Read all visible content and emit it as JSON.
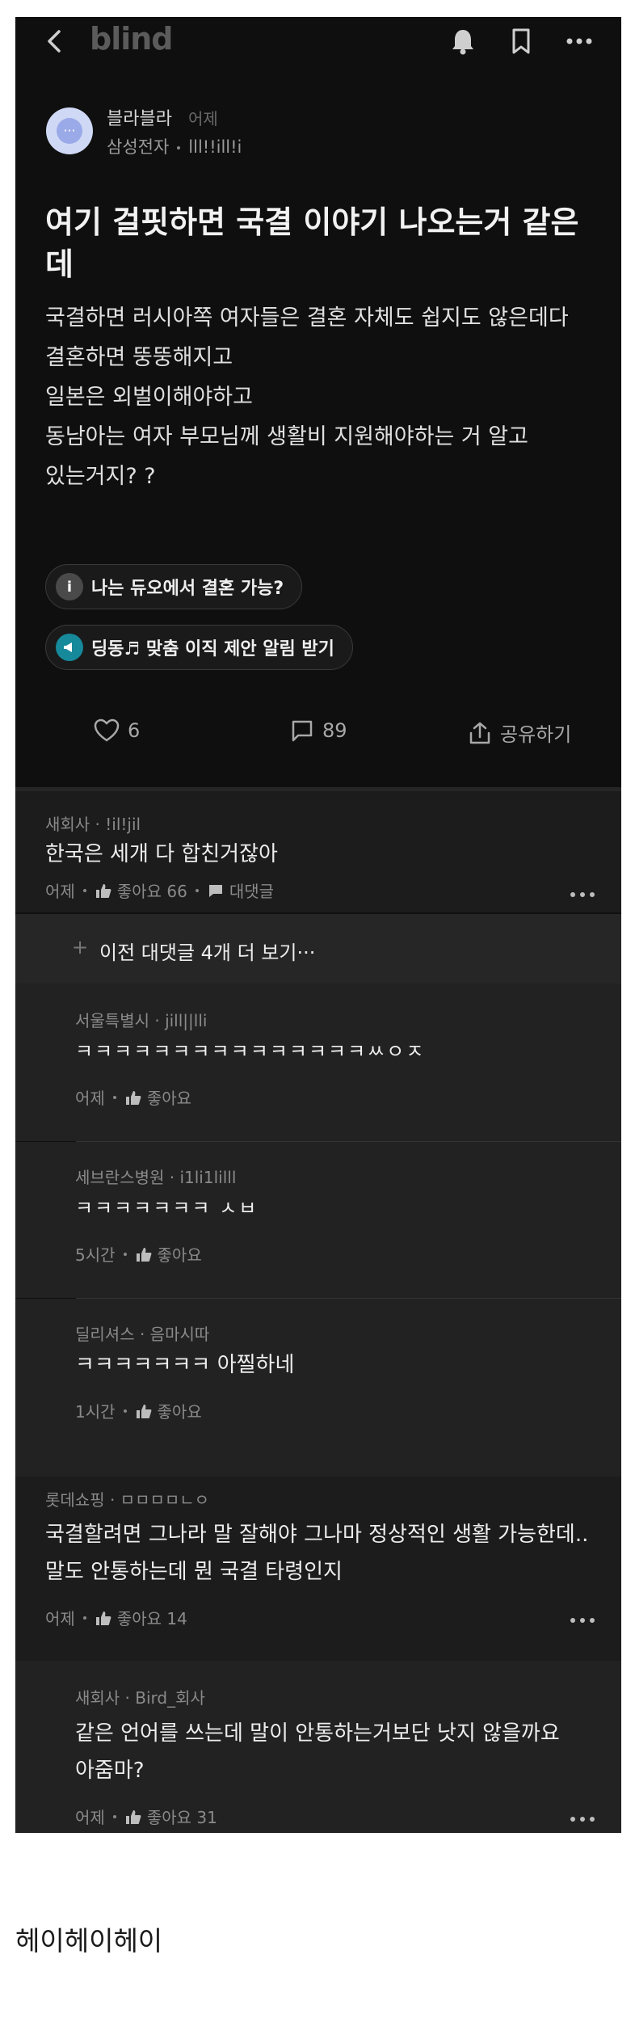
{
  "topbar": {
    "logo": "blind"
  },
  "post": {
    "author": "블라블라",
    "time": "어제",
    "company": "삼성전자",
    "handle": "lll!!ill!i",
    "title": "여기 걸핏하면 국결 이야기 나오는거 같은데",
    "body": [
      "국결하면 러시아쪽 여자들은 결혼 자체도 쉽지도 않은데다",
      "결혼하면 뚱뚱해지고",
      "일본은 외벌이해야하고",
      "동남아는 여자 부모님께 생활비 지원해야하는 거 알고",
      "있는거지? ?"
    ],
    "chip1": "나는 듀오에서 결혼 가능?",
    "chip2": "딩동♬ 맞춤 이직 제안 알림 받기",
    "likes": "6",
    "comments": "89",
    "share": "공유하기"
  },
  "comments": [
    {
      "meta": "새회사 · !il!jil",
      "text": "한국은 세개 다 합친거잖아",
      "time": "어제",
      "like": "좋아요 66",
      "reply": "대댓글"
    }
  ],
  "prev_replies": "이전 대댓글 4개 더 보기···",
  "replies": [
    {
      "meta": "서울특별시 · jill||lli",
      "text": "ㅋㅋㅋㅋㅋㅋㅋㅋㅋㅋㅋㅋㅋㅋㅋㅆㅇㅈ",
      "time": "어제",
      "like": "좋아요"
    },
    {
      "meta": "세브란스병원 · i1li1lilll",
      "text": "ㅋㅋㅋㅋㅋㅋㅋ ㅅㅂ",
      "time": "5시간",
      "like": "좋아요"
    },
    {
      "meta": "딜리셔스 · 음마시따",
      "text": "ㅋㅋㅋㅋㅋㅋㅋ 아찔하네",
      "time": "1시간",
      "like": "좋아요"
    }
  ],
  "comment2": {
    "meta": "롯데쇼핑 · ㅁㅁㅁㅁㄴㅇ",
    "text1": "국결할려면 그나라 말 잘해야 그나마 정상적인 생활 가능한데..",
    "text2": "말도 안통하는데 뭔 국결 타령인지",
    "time": "어제",
    "like": "좋아요 14"
  },
  "reply2": {
    "meta": "새회사 · Bird_회사",
    "text1": "같은 언어를 쓰는데 말이 안통하는거보단 낫지 않을까요",
    "text2": "아줌마?",
    "time": "어제",
    "like": "좋아요 31"
  },
  "footer": "헤이헤이헤이"
}
